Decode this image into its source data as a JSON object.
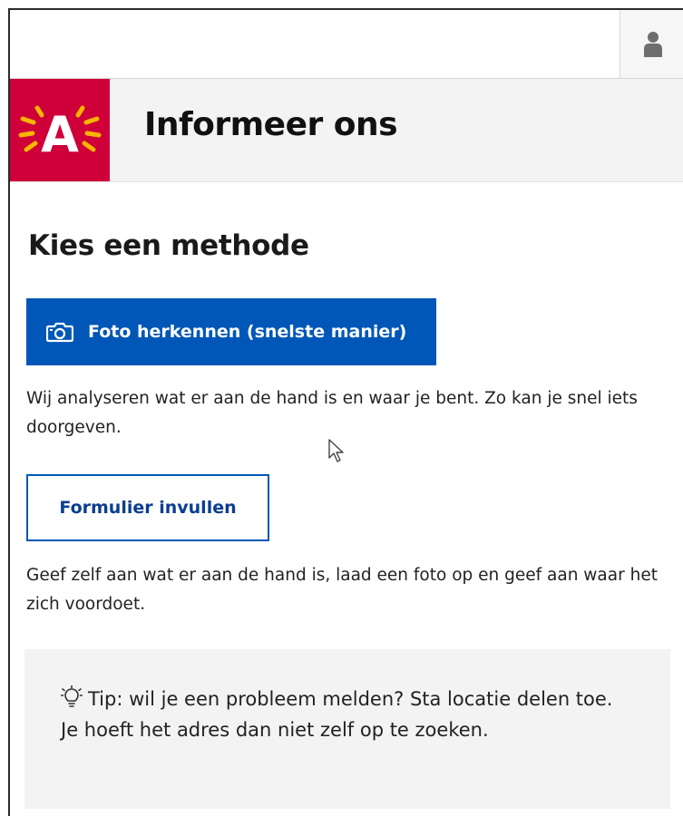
{
  "header": {
    "title": "Informeer ons",
    "logo_letter": "A",
    "brand_color": "#cf0039",
    "user_icon": "user-icon"
  },
  "main": {
    "heading": "Kies een methode",
    "photo_button": {
      "label": "Foto herkennen (snelste manier)",
      "icon": "camera-icon",
      "color": "#0057b7"
    },
    "photo_description": "Wij analyseren wat er aan de hand is en waar je bent. Zo kan je snel iets doorgeven.",
    "form_button": {
      "label": "Formulier invullen"
    },
    "form_description": "Geef zelf aan wat er aan de hand is, laad een foto op en geef aan waar het zich voordoet."
  },
  "tip": {
    "icon": "lightbulb-icon",
    "text": "Tip: wil je een probleem melden? Sta locatie delen toe. Je hoeft het adres dan niet zelf op te zoeken."
  }
}
